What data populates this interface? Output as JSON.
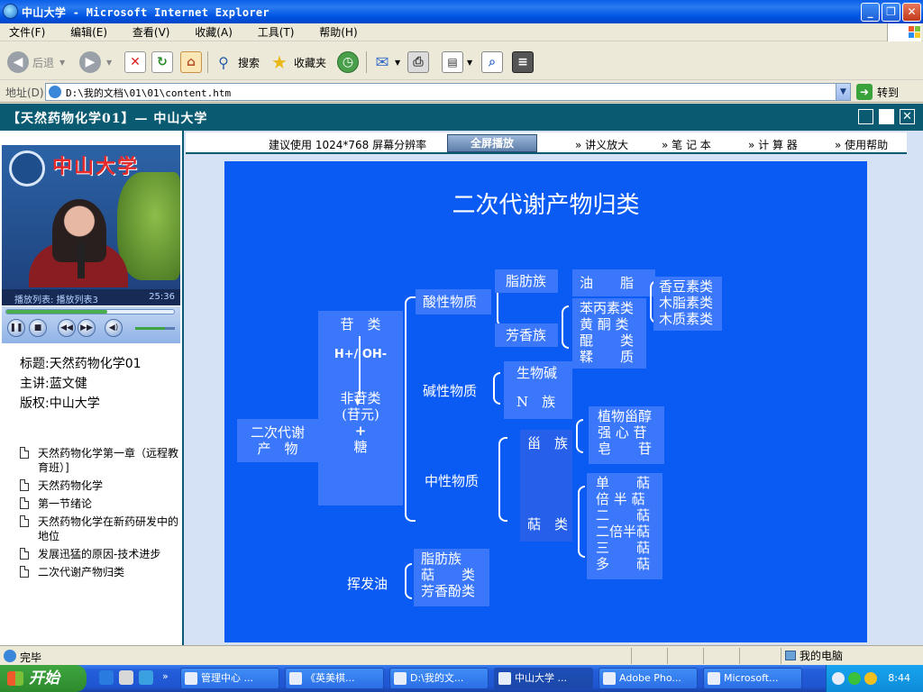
{
  "window": {
    "title": "中山大学 - Microsoft Internet Explorer",
    "min_label": "_",
    "restore_label": "❐",
    "close_label": "✕"
  },
  "menu": [
    "文件(F)",
    "编辑(E)",
    "查看(V)",
    "收藏(A)",
    "工具(T)",
    "帮助(H)"
  ],
  "toolbar": {
    "back": "后退",
    "search": "搜索",
    "favorites": "收藏夹"
  },
  "address": {
    "label": "地址(D)",
    "url": "D:\\我的文档\\01\\01\\content.htm",
    "go": "转到"
  },
  "page": {
    "header": "【天然药物化学01】— 中山大学",
    "nav": {
      "resolution": "建议使用 1024*768 屏幕分辨率",
      "fullscreen": "全屏播放",
      "links": [
        "» 讲义放大",
        "» 笔 记 本",
        "» 计 算 器",
        "» 使用帮助"
      ]
    },
    "video": {
      "overlay_title": "中山大学",
      "playlist": "播放列表: 播放列表3",
      "time": "25:36",
      "progress": 0.6,
      "volume": 0.75
    },
    "meta": {
      "title": "标题:天然药物化学01",
      "host": "主讲:蓝文健",
      "copyright": "版权:中山大学"
    },
    "outline": [
      "天然药物化学第一章（远程教育班）]",
      "天然药物化学",
      "第一节绪论",
      "天然药物化学在新药研发中的地位",
      "发展迅猛的原因-技术进步",
      "二次代谢产物归类"
    ],
    "slide": {
      "title": "二次代谢产物归类",
      "root": [
        "二次代谢",
        "产　物"
      ],
      "glyco": [
        "苷　类",
        "H+/  OH-",
        "非苷类",
        "(苷元)",
        "+",
        "糖"
      ],
      "acidic": "酸性物质",
      "basic": "碱性物质",
      "neutral": "中性物质",
      "volatile": "挥发油",
      "acid_children": [
        "脂肪族",
        "芳香族"
      ],
      "fat_child": "油　　脂",
      "aromatic_children": [
        "苯丙素类",
        "黄 酮 类",
        "醌　　类",
        "鞣　　质"
      ],
      "phenylpropanoid_children": [
        "香豆素类",
        "木脂素类",
        "木质素类"
      ],
      "basic_children": [
        "生物碱",
        "N　族"
      ],
      "neutral_children": [
        "甾　族",
        "萜　类"
      ],
      "steroid_children": [
        "植物甾醇",
        "强 心 苷",
        "皂　　苷"
      ],
      "terpene_children": [
        "单　　萜",
        "倍 半 萜",
        "二　　萜",
        "二倍半萜",
        "三　　萜",
        "多　　萜"
      ],
      "oil_children": [
        "脂肪族",
        "萜　　类",
        "芳香酚类"
      ]
    }
  },
  "status": {
    "text": "完毕",
    "zone": "我的电脑"
  },
  "taskbar": {
    "start": "开始",
    "tasks": [
      "管理中心 ...",
      "《英美棋...",
      "D:\\我的文...",
      "中山大学 ...",
      "Adobe Pho...",
      "Microsoft..."
    ],
    "time": "8:44"
  }
}
